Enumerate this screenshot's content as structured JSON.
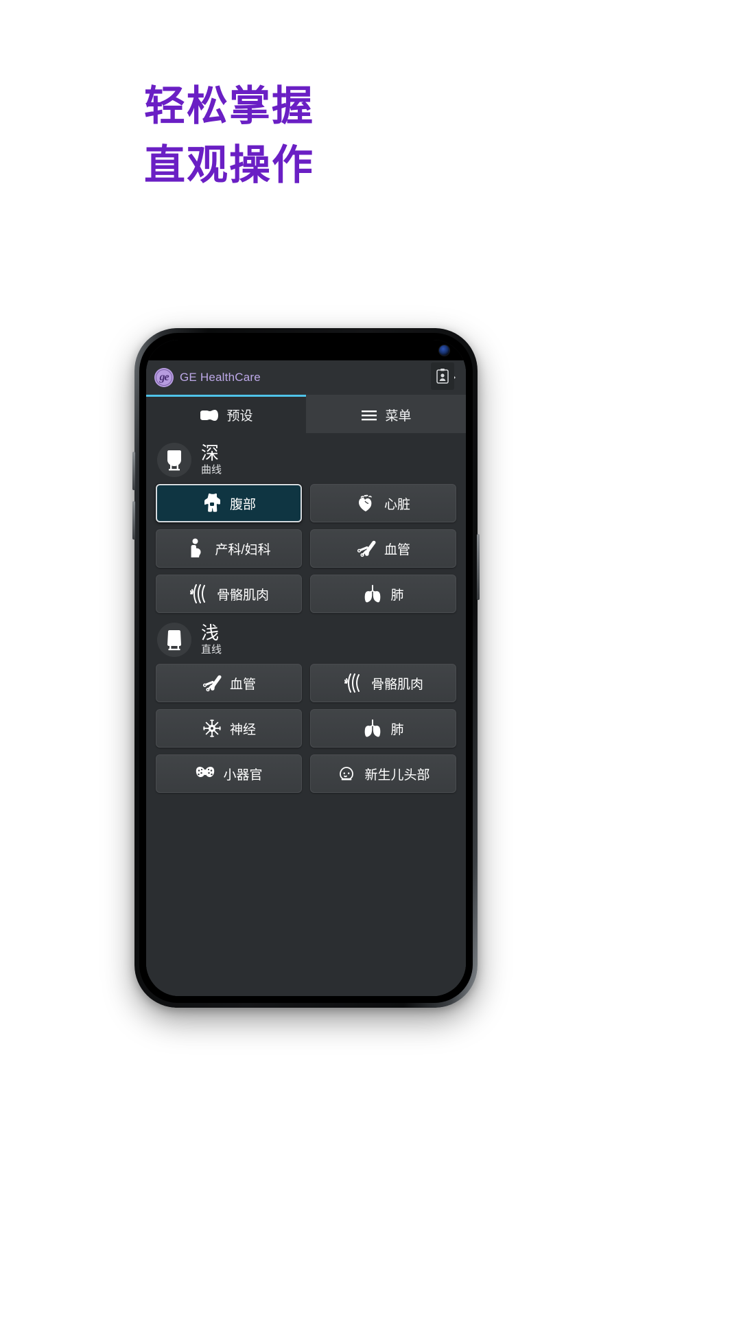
{
  "headline": {
    "line1": "轻松掌握",
    "line2": "直观操作",
    "color": "#6a1fc4"
  },
  "app": {
    "brand": "GE HealthCare",
    "logo_text": "ge",
    "logout_icon": "logout-icon",
    "accent_color": "#4fc3e8",
    "tabs": [
      {
        "label": "预设",
        "icon": "probe-icon",
        "active": true
      },
      {
        "label": "菜单",
        "icon": "hamburger-icon",
        "active": false
      }
    ],
    "groups": [
      {
        "title": "深",
        "subtitle": "曲线",
        "icon": "curved-probe-icon",
        "presets": [
          {
            "label": "腹部",
            "icon": "torso-icon",
            "selected": true
          },
          {
            "label": "心脏",
            "icon": "heart-icon",
            "selected": false
          },
          {
            "label": "产科/妇科",
            "icon": "pregnant-woman-icon",
            "selected": false
          },
          {
            "label": "血管",
            "icon": "vascular-icon",
            "selected": false
          },
          {
            "label": "骨骼肌肉",
            "icon": "musculoskeletal-icon",
            "selected": false
          },
          {
            "label": "肺",
            "icon": "lungs-icon",
            "selected": false
          }
        ]
      },
      {
        "title": "浅",
        "subtitle": "直线",
        "icon": "linear-probe-icon",
        "presets": [
          {
            "label": "血管",
            "icon": "vascular-icon",
            "selected": false
          },
          {
            "label": "骨骼肌肉",
            "icon": "musculoskeletal-icon",
            "selected": false
          },
          {
            "label": "神经",
            "icon": "nerve-icon",
            "selected": false
          },
          {
            "label": "肺",
            "icon": "lungs-icon",
            "selected": false
          },
          {
            "label": "小器官",
            "icon": "thyroid-icon",
            "selected": false
          },
          {
            "label": "新生儿头部",
            "icon": "neonatal-head-icon",
            "selected": false
          }
        ]
      }
    ]
  }
}
